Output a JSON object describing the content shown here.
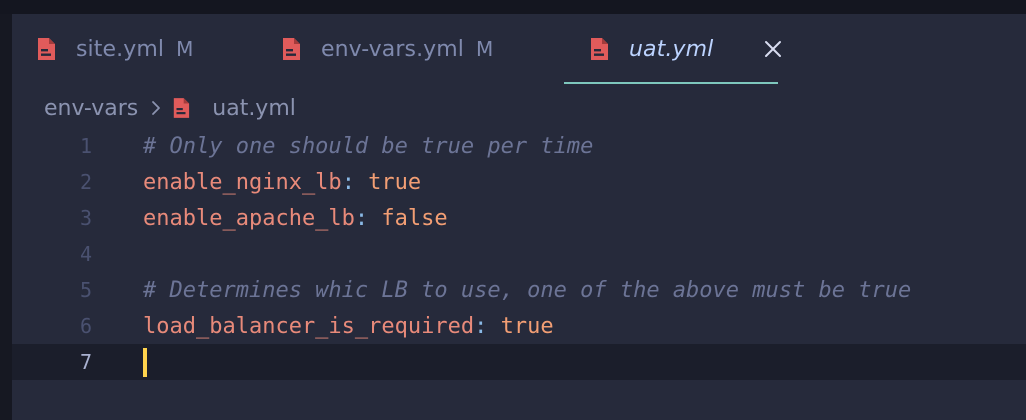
{
  "colors": {
    "background": "#262a3b",
    "file_icon": "#e05b5b",
    "active_tab_underline": "#7ec7bd",
    "comment": "#6c7496",
    "key": "#e88a7a",
    "value": "#f29e74",
    "cursor": "#ffd34d"
  },
  "tabs": [
    {
      "icon": "yaml-file-icon",
      "label": "site.yml",
      "status": "M",
      "active": false
    },
    {
      "icon": "yaml-file-icon",
      "label": "env-vars.yml",
      "status": "M",
      "active": false
    },
    {
      "icon": "yaml-file-icon",
      "label": "uat.yml",
      "status": "",
      "active": true,
      "close_icon": "close-icon"
    }
  ],
  "breadcrumb": {
    "folder": "env-vars",
    "separator_icon": "chevron-right-icon",
    "file_icon": "yaml-file-icon",
    "file": "uat.yml"
  },
  "editor": {
    "lines": [
      {
        "number": "1",
        "comment": "# Only one should be true per time"
      },
      {
        "number": "2",
        "key": "enable_nginx_lb",
        "colon": ":",
        "value": " true"
      },
      {
        "number": "3",
        "key": "enable_apache_lb",
        "colon": ":",
        "value": " false"
      },
      {
        "number": "4"
      },
      {
        "number": "5",
        "comment": "# Determines whic LB to use, one of the above must be true"
      },
      {
        "number": "6",
        "key": "load_balancer_is_required",
        "colon": ":",
        "value": " true"
      },
      {
        "number": "7"
      }
    ],
    "current_line": "7"
  }
}
